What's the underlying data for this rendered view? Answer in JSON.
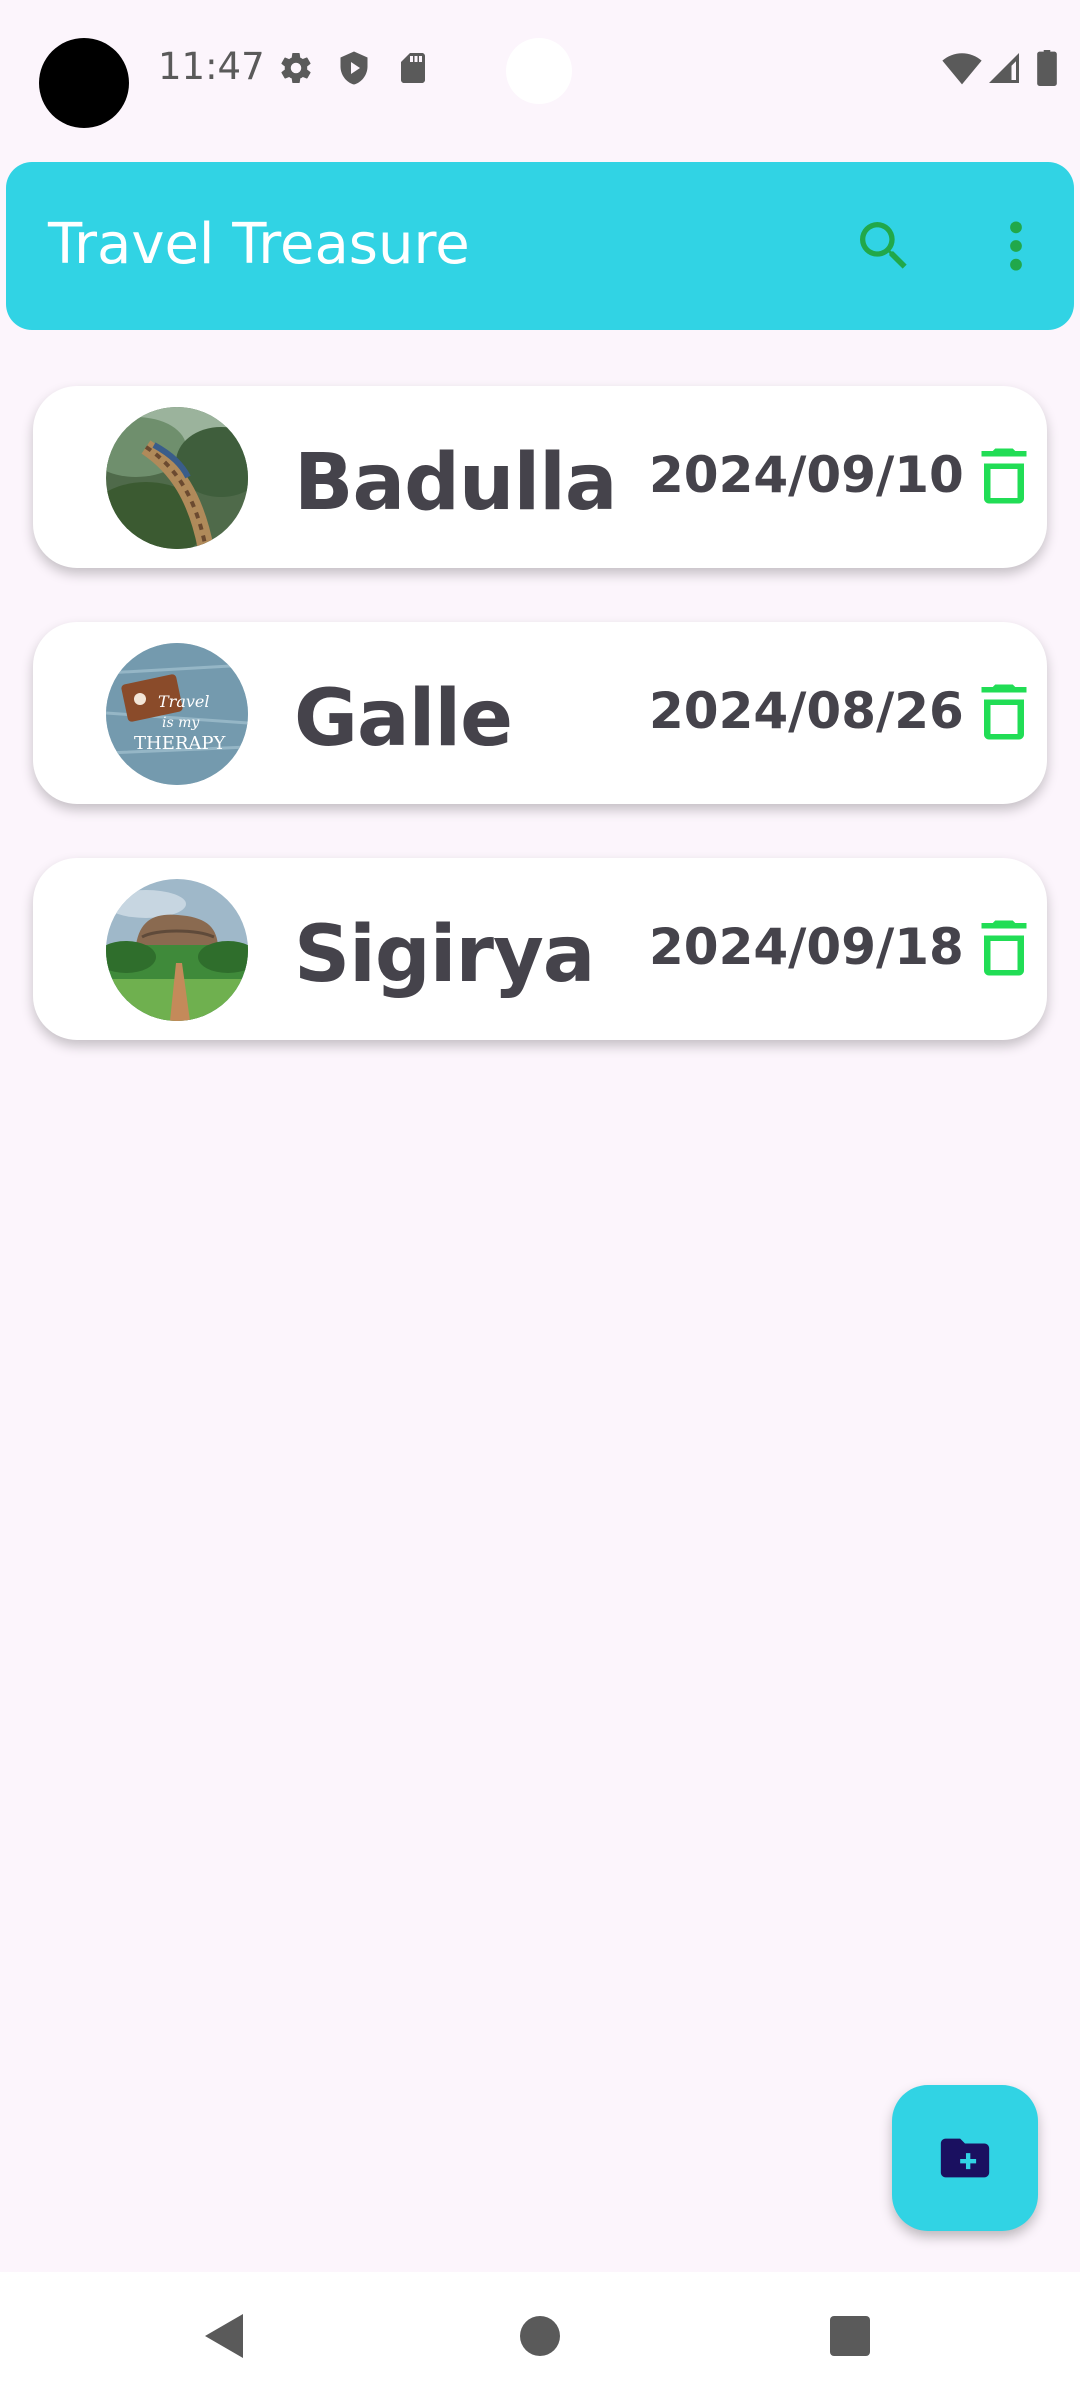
{
  "status_bar": {
    "time": "11:47",
    "icons_left": [
      "gear-icon",
      "shield-icon",
      "sd-card-icon"
    ],
    "icons_right": [
      "wifi-icon",
      "signal-icon",
      "battery-icon"
    ]
  },
  "app_bar": {
    "title": "Travel Treasure",
    "actions": [
      "search-icon",
      "more-vert-icon"
    ]
  },
  "trips": [
    {
      "name": "Badulla",
      "date": "2024/09/10",
      "thumb": "railway-bridge-in-forest"
    },
    {
      "name": "Galle",
      "date": "2024/08/26",
      "thumb": "travel-is-my-therapy-denim"
    },
    {
      "name": "Sigirya",
      "date": "2024/09/18",
      "thumb": "sigiriya-rock-with-gardens"
    }
  ],
  "fab": {
    "icon": "create-new-folder-icon"
  },
  "nav_bar": {
    "buttons": [
      "back",
      "home",
      "recents"
    ]
  },
  "colors": {
    "accent": "#31d3e4",
    "icon_green": "#21c55d",
    "text_dark": "#45434b",
    "background": "#fcf5fc",
    "fab_icon": "#1a1060"
  }
}
